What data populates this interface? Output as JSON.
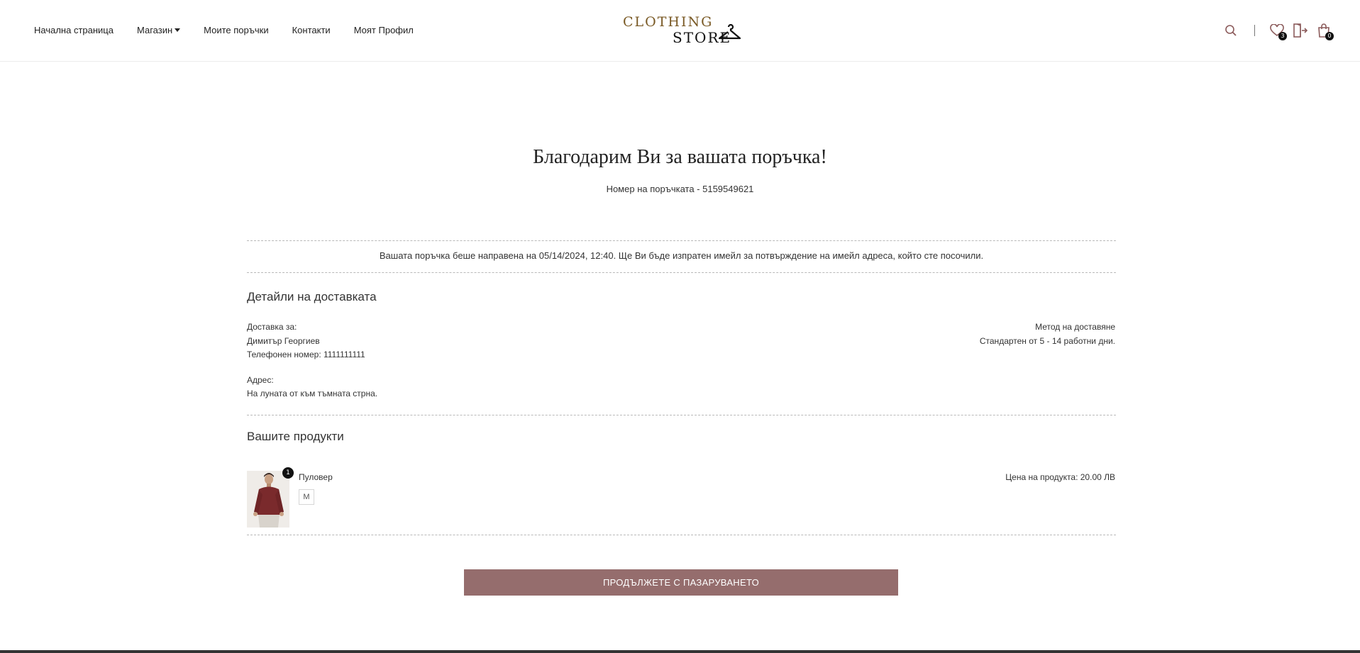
{
  "header": {
    "nav": [
      {
        "label": "Начална страница"
      },
      {
        "label": "Магазин"
      },
      {
        "label": "Моите поръчки"
      },
      {
        "label": "Контакти"
      },
      {
        "label": "Моят  Профил"
      }
    ],
    "logo": {
      "line1": "CLOTHING",
      "line2": "STORE"
    },
    "wishlist_count": "3",
    "cart_count": "0",
    "icons": [
      "search-icon",
      "heart-icon",
      "logout-icon",
      "shopping-bag-icon"
    ]
  },
  "main": {
    "title": "Благодарим Ви за вашата поръчка!",
    "order_number": "Номер на поръчката - 5159549621",
    "notice": "Вашата поръчка беше направена на 05/14/2024, 12:40.  Ще  Ви бъде изпратен имейл за потвърждение на имейл адреса, който сте посочили.",
    "delivery": {
      "title": "Детайли на доставката",
      "deliver_to_label": "Доставка за:",
      "name": "Димитър  Георгиев",
      "phone": "Телефонен номер: 1111111111",
      "address_label": "Адрес:",
      "address": "На луната от към тъмната стрна.",
      "method_label": "Метод на доставяне",
      "method_value": "Стандартен от 5 - 14 работни дни."
    },
    "products": {
      "title": "Вашите продукти",
      "items": [
        {
          "name": "Пуловер",
          "size": "M",
          "quantity": "1",
          "price": "Цена на продукта: 20.00 ЛВ"
        }
      ]
    },
    "continue_button": "ПРОДЪЛЖЕТЕ С  ПАЗАРУВАНЕТО"
  },
  "colors": {
    "accent": "#956d6d",
    "logo_gold": "#7a5a26",
    "icon": "#8b5b5b"
  }
}
